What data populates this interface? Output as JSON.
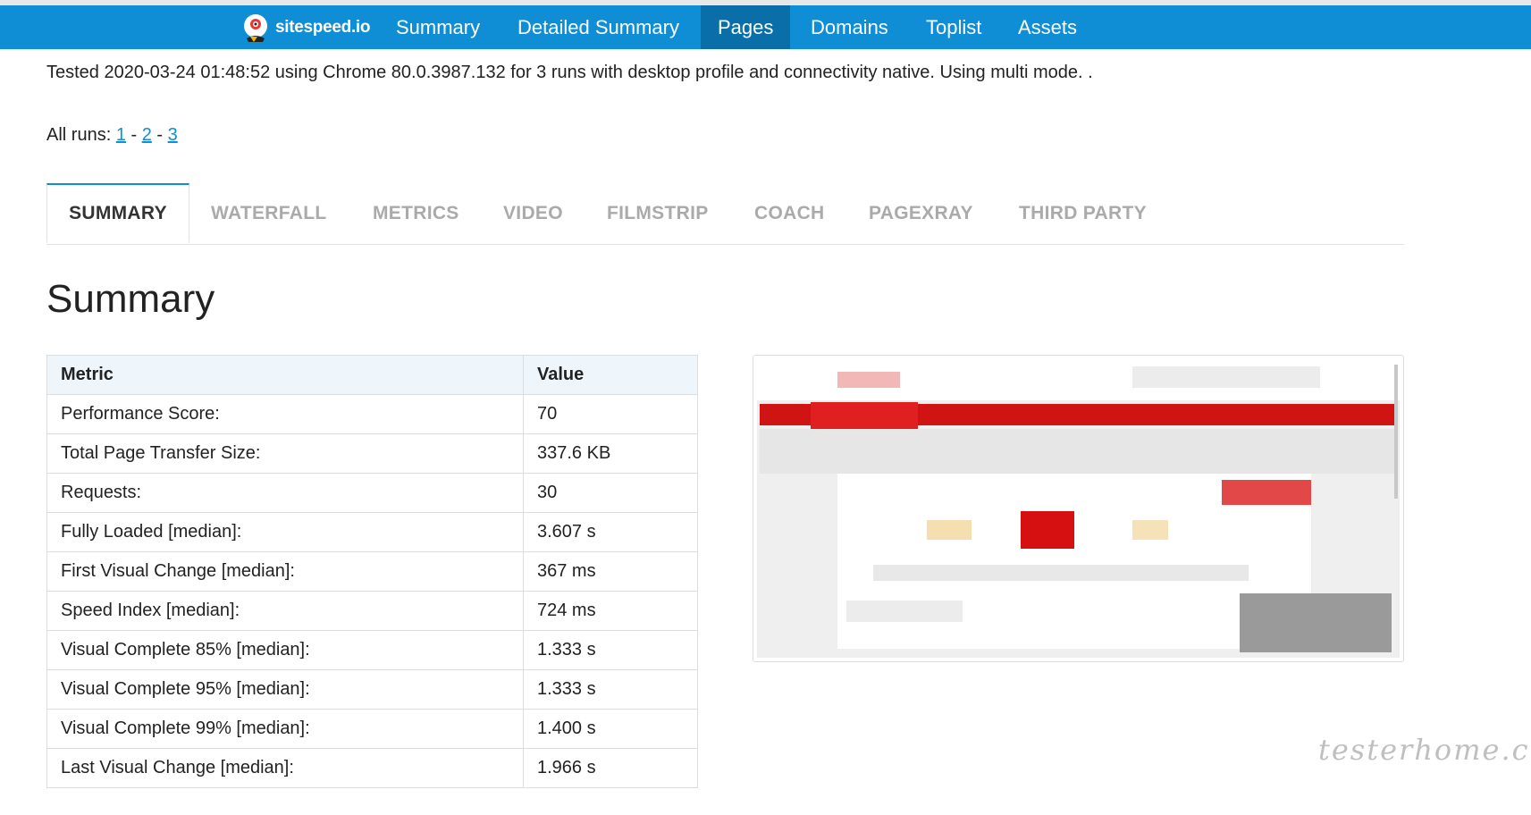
{
  "app": {
    "brand": "sitespeed.io"
  },
  "navbar": {
    "items": [
      {
        "label": "Summary",
        "active": false
      },
      {
        "label": "Detailed Summary",
        "active": false
      },
      {
        "label": "Pages",
        "active": true
      },
      {
        "label": "Domains",
        "active": false
      },
      {
        "label": "Toplist",
        "active": false
      },
      {
        "label": "Assets",
        "active": false
      }
    ]
  },
  "info": {
    "tested": "Tested 2020-03-24 01:48:52 using Chrome 80.0.3987.132 for 3 runs with desktop profile and connectivity native. Using multi mode.  .",
    "runs_label": "All runs:",
    "runs": [
      "1",
      "2",
      "3"
    ],
    "runs_separator": " - "
  },
  "tabs": [
    {
      "label": "SUMMARY",
      "active": true
    },
    {
      "label": "WATERFALL",
      "active": false
    },
    {
      "label": "METRICS",
      "active": false
    },
    {
      "label": "VIDEO",
      "active": false
    },
    {
      "label": "FILMSTRIP",
      "active": false
    },
    {
      "label": "COACH",
      "active": false
    },
    {
      "label": "PAGEXRAY",
      "active": false
    },
    {
      "label": "THIRD PARTY",
      "active": false
    }
  ],
  "summary": {
    "heading": "Summary",
    "columns": [
      "Metric",
      "Value"
    ],
    "rows": [
      {
        "metric": "Performance Score:",
        "value": "70"
      },
      {
        "metric": "Total Page Transfer Size:",
        "value": "337.6 KB"
      },
      {
        "metric": "Requests:",
        "value": "30"
      },
      {
        "metric": "Fully Loaded [median]:",
        "value": "3.607 s"
      },
      {
        "metric": "First Visual Change [median]:",
        "value": "367 ms"
      },
      {
        "metric": "Speed Index [median]:",
        "value": "724 ms"
      },
      {
        "metric": "Visual Complete 85% [median]:",
        "value": "1.333 s"
      },
      {
        "metric": "Visual Complete 95% [median]:",
        "value": "1.333 s"
      },
      {
        "metric": "Visual Complete 99% [median]:",
        "value": "1.400 s"
      },
      {
        "metric": "Last Visual Change [median]:",
        "value": "1.966 s"
      }
    ]
  },
  "watermark": "testerhome.com",
  "colors": {
    "navbar": "#0f8ed6",
    "navbar_active": "#0a6fa9",
    "link": "#0f8ed6",
    "table_header": "#eef6fc"
  }
}
